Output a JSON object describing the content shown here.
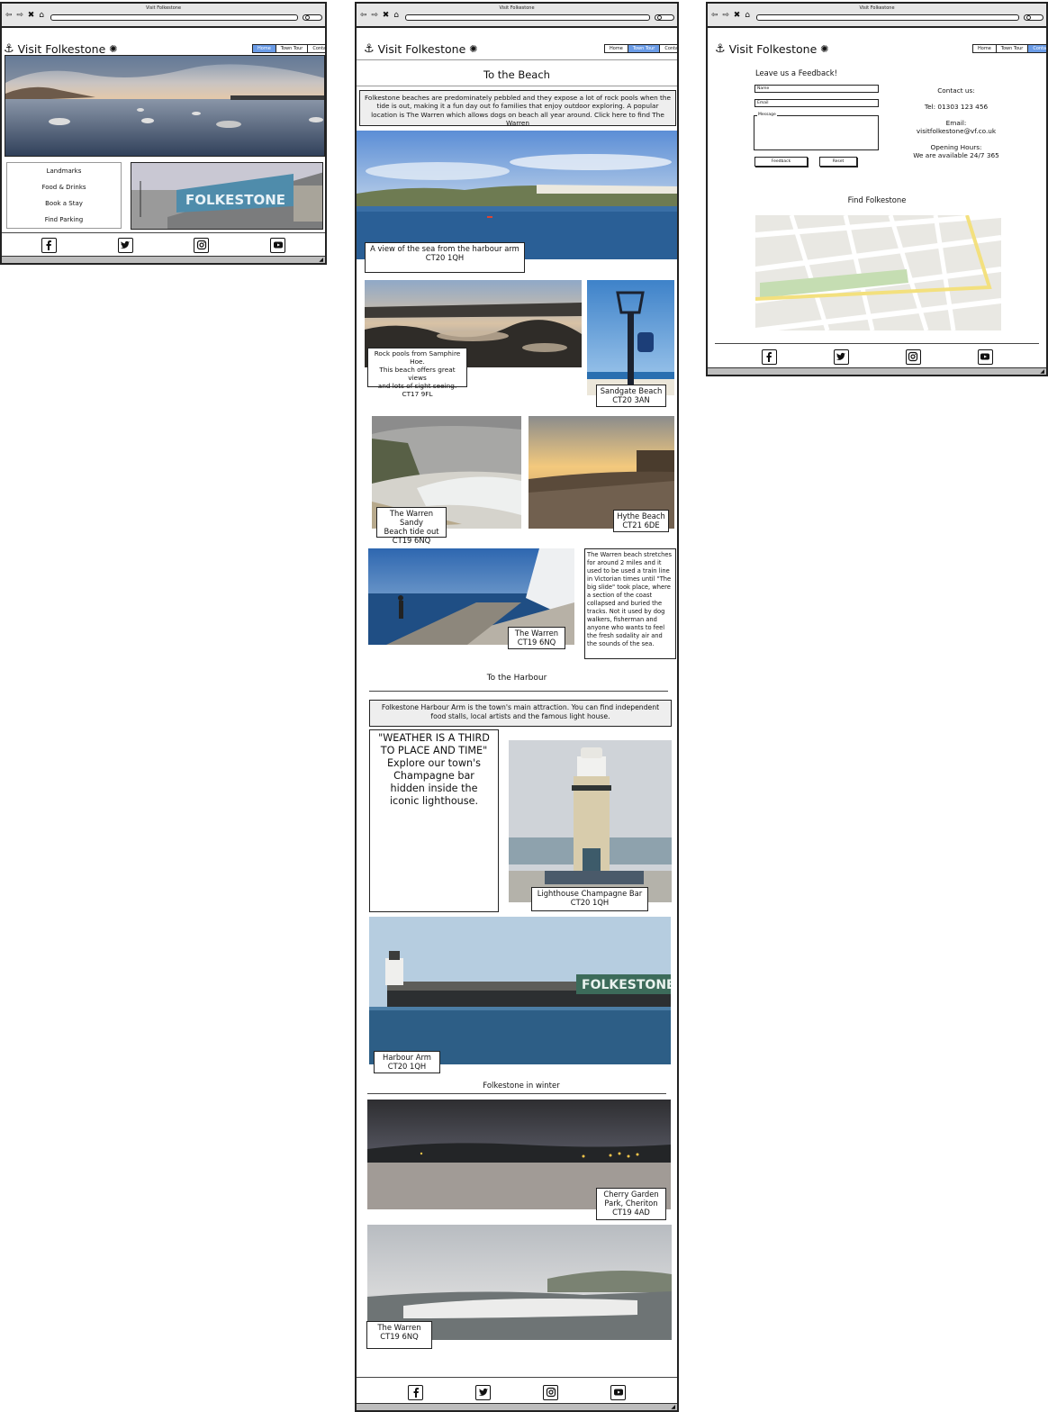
{
  "window_title": "Visit Folkestone",
  "nav_glyphs": "⇦ ⇨ ✖ ⌂",
  "brand": "Visit Folkestone",
  "nav": {
    "home": "Home",
    "tour": "Town Tour",
    "contact": "Contact"
  },
  "home": {
    "menu": [
      "Landmarks",
      "Food & Drinks",
      "Book a Stay",
      "Find Parking"
    ],
    "sign_text": "FOLKESTONE"
  },
  "tour": {
    "beach_title": "To the Beach",
    "beach_intro": "Folkestone beaches are predominately pebbled and they expose a lot of rock pools when the tide is out, making it a fun day out fo families that enjoy outdoor exploring. A popular location is The Warren which allows dogs on beach all year around.  Click here to find The Warren",
    "cap_sea": "A view of the sea from the harbour arm\nCT20 1QH",
    "cap_rock": "Rock pools from Samphire Hoe.\nThis beach offers great views\nand lots of sight seeing.\nCT17 9FL",
    "cap_sandgate": "Sandgate Beach\nCT20 3AN",
    "cap_warren_sandy": "The Warren Sandy\nBeach tide out\nCT19 6NQ",
    "cap_hythe": "Hythe Beach\nCT21 6DE",
    "cap_warren": "The Warren\nCT19 6NQ",
    "warren_desc": "The Warren beach stretches for around 2 miles and it used to be used a train line in Victorian times until \"The big slide\" took place, where a section of the coast collapsed and buried the tracks. Not it used by dog walkers, fisherman and anyone who wants to feel the fresh sodality air and the sounds of the sea.",
    "harbour_title": "To the Harbour",
    "harbour_intro": "Folkestone Harbour Arm is the town's main attraction. You can find independent food stalls, local artists and the famous light house.",
    "quote": "\"WEATHER IS A THIRD TO PLACE AND TIME\" Explore our town's Champagne bar hidden inside the iconic lighthouse.",
    "cap_lighthouse": "Lighthouse Champagne Bar\nCT20 1QH",
    "cap_harbour_arm": "Harbour Arm\nCT20 1QH",
    "winter_title": "Folkestone in winter",
    "cap_cherry": "Cherry Garden\nPark, Cheriton\nCT19 4AD",
    "cap_warren_winter": "The Warren\nCT19 6NQ",
    "sign_text": "FOLKESTONE"
  },
  "contact": {
    "feedback_title": "Leave us a Feedback!",
    "name_label": "Name",
    "email_label": "Email",
    "message_label": "Message",
    "feedback_btn": "Feedback",
    "reset_btn": "Reset",
    "contact_us": "Contact us:",
    "tel": "Tel: 01303 123 456",
    "email_heading": "Email:",
    "email": "visitfolkestone@vf.co.uk",
    "hours_heading": "Opening Hours:",
    "hours": "We are available 24/7 365",
    "find_title": "Find Folkestone"
  },
  "social_icons": [
    "facebook-icon",
    "twitter-icon",
    "instagram-icon",
    "youtube-icon"
  ]
}
